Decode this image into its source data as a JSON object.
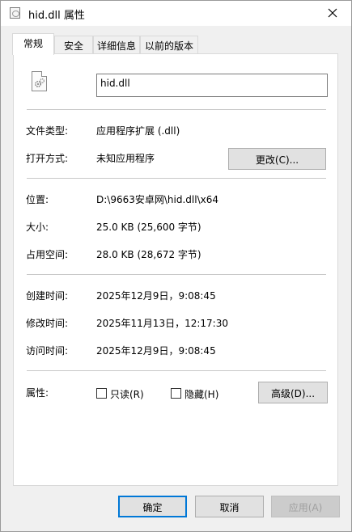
{
  "window": {
    "title": "hid.dll 属性",
    "icon": "file-properties-icon",
    "close_icon": "close-icon"
  },
  "tabs": [
    {
      "label": "常规",
      "active": true
    },
    {
      "label": "安全",
      "active": false
    },
    {
      "label": "详细信息",
      "active": false
    },
    {
      "label": "以前的版本",
      "active": false
    }
  ],
  "file": {
    "icon": "dll-gear-icon",
    "name": "hid.dll"
  },
  "type_section": {
    "file_type_label": "文件类型:",
    "file_type_value": "应用程序扩展 (.dll)",
    "open_with_label": "打开方式:",
    "open_with_value": "未知应用程序",
    "change_button": "更改(C)..."
  },
  "location_section": {
    "location_label": "位置:",
    "location_value": "D:\\9663安卓网\\hid.dll\\x64",
    "size_label": "大小:",
    "size_value": "25.0 KB (25,600 字节)",
    "size_on_disk_label": "占用空间:",
    "size_on_disk_value": "28.0 KB (28,672 字节)"
  },
  "time_section": {
    "created_label": "创建时间:",
    "created_value": "2025年12月9日，9:08:45",
    "modified_label": "修改时间:",
    "modified_value": "2025年11月13日，12:17:30",
    "accessed_label": "访问时间:",
    "accessed_value": "2025年12月9日，9:08:45"
  },
  "attributes": {
    "label": "属性:",
    "readonly_label": "只读(R)",
    "readonly_checked": false,
    "hidden_label": "隐藏(H)",
    "hidden_checked": false,
    "advanced_button": "高级(D)..."
  },
  "footer": {
    "ok": "确定",
    "cancel": "取消",
    "apply": "应用(A)"
  },
  "colors": {
    "accent": "#0078d7",
    "panel_bg": "#ffffff",
    "window_bg": "#f0f0f0"
  }
}
